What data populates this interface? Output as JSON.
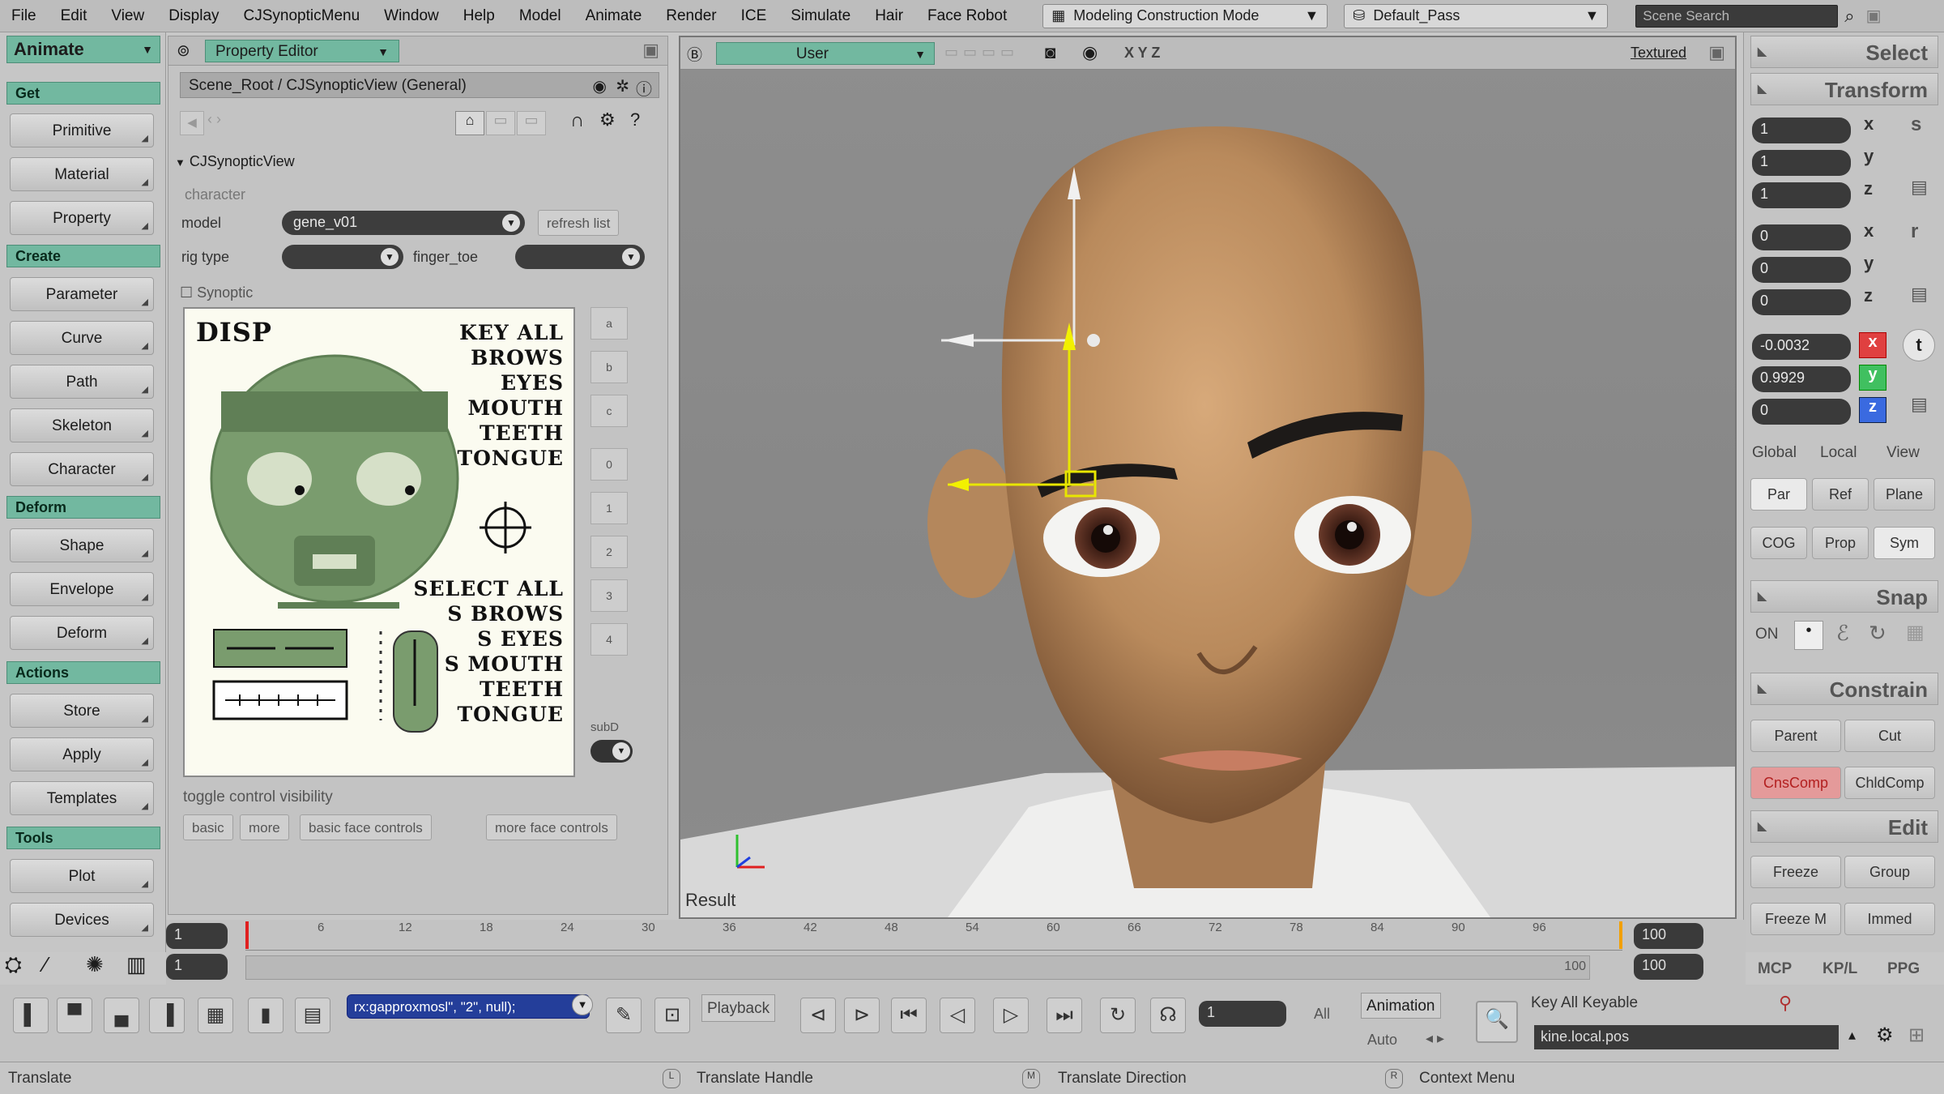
{
  "menubar": {
    "items": [
      "File",
      "Edit",
      "View",
      "Display",
      "CJSynopticMenu",
      "Window",
      "Help",
      "Model",
      "Animate",
      "Render",
      "ICE",
      "Simulate",
      "Hair",
      "Face Robot"
    ],
    "mode": "Modeling Construction Mode",
    "pass": "Default_Pass",
    "search_placeholder": "Scene Search"
  },
  "left_toolbar": {
    "module": "Animate",
    "sections": [
      {
        "header": "Get",
        "buttons": [
          "Primitive",
          "Material",
          "Property"
        ]
      },
      {
        "header": "Create",
        "buttons": [
          "Parameter",
          "Curve",
          "Path",
          "Skeleton",
          "Character"
        ]
      },
      {
        "header": "Deform",
        "buttons": [
          "Shape",
          "Envelope",
          "Deform"
        ]
      },
      {
        "header": "Actions",
        "buttons": [
          "Store",
          "Apply",
          "Templates"
        ]
      },
      {
        "header": "Tools",
        "buttons": [
          "Plot",
          "Devices"
        ]
      }
    ]
  },
  "property_editor": {
    "title": "Property Editor",
    "path": "Scene_Root / CJSynopticView (General)",
    "section": "CJSynopticView",
    "group_character": "character",
    "model_label": "model",
    "model_value": "gene_v01",
    "refresh_label": "refresh list",
    "rig_type_label": "rig type",
    "rig_type_value": "",
    "finger_toe_label": "finger_toe",
    "finger_toe_value": "",
    "synoptic_label": "Synoptic",
    "synoptic": {
      "disp": "DISP",
      "key_all": [
        "KEY ALL",
        "BROWS",
        "EYES",
        "MOUTH",
        "TEETH",
        "TONGUE"
      ],
      "select_all": [
        "SELECT ALL",
        "S  BROWS",
        "S  EYES",
        "S MOUTH",
        "TEETH",
        "TONGUE"
      ]
    },
    "side_buttons": [
      "a",
      "b",
      "c",
      "0",
      "1",
      "2",
      "3",
      "4"
    ],
    "subd_label": "subD",
    "visibility_label": "toggle control visibility",
    "visibility_buttons": [
      "basic",
      "more",
      "basic face controls",
      "more face controls"
    ]
  },
  "viewport": {
    "camera": "User",
    "axes_label": "X Y Z",
    "shading": "Textured",
    "pass_label": "Result"
  },
  "right_panel": {
    "select": "Select",
    "transform": "Transform",
    "scale": [
      "1",
      "1",
      "1"
    ],
    "rotate": [
      "0",
      "0",
      "0"
    ],
    "translate": [
      "-0.0032",
      "0.9929",
      "0"
    ],
    "axes": [
      "x",
      "y",
      "z"
    ],
    "side_icons": [
      "s",
      "r",
      "t"
    ],
    "ref_modes": [
      "Global",
      "Local",
      "View"
    ],
    "ref_buttons": [
      "Par",
      "Ref",
      "Plane"
    ],
    "ref_buttons2": [
      "COG",
      "Prop",
      "Sym"
    ],
    "snap": "Snap",
    "snap_on": "ON",
    "constrain": "Constrain",
    "constrain_buttons": [
      "Parent",
      "Cut",
      "CnsComp",
      "ChldComp"
    ],
    "edit": "Edit",
    "edit_buttons": [
      "Freeze",
      "Group",
      "Freeze M",
      "Immed"
    ],
    "bottom_tabs": [
      "MCP",
      "KP/L",
      "PPG"
    ]
  },
  "timeline": {
    "start": "1",
    "current": "1",
    "end": "100",
    "end2": "100",
    "range_end": "100",
    "frames": [
      "6",
      "12",
      "18",
      "24",
      "30",
      "36",
      "42",
      "48",
      "54",
      "60",
      "66",
      "72",
      "78",
      "84",
      "90",
      "96"
    ]
  },
  "bottombar": {
    "script": "rx:gapproxmosl\", \"2\", null);",
    "playback": "Playback",
    "frame": "1",
    "all": "All",
    "animation": "Animation",
    "auto": "Auto",
    "key_all": "Key All Keyable",
    "cmd": "kine.local.pos"
  },
  "status": {
    "left": "Translate",
    "l": "Translate Handle",
    "m": "Translate Direction",
    "r": "Context Menu"
  }
}
